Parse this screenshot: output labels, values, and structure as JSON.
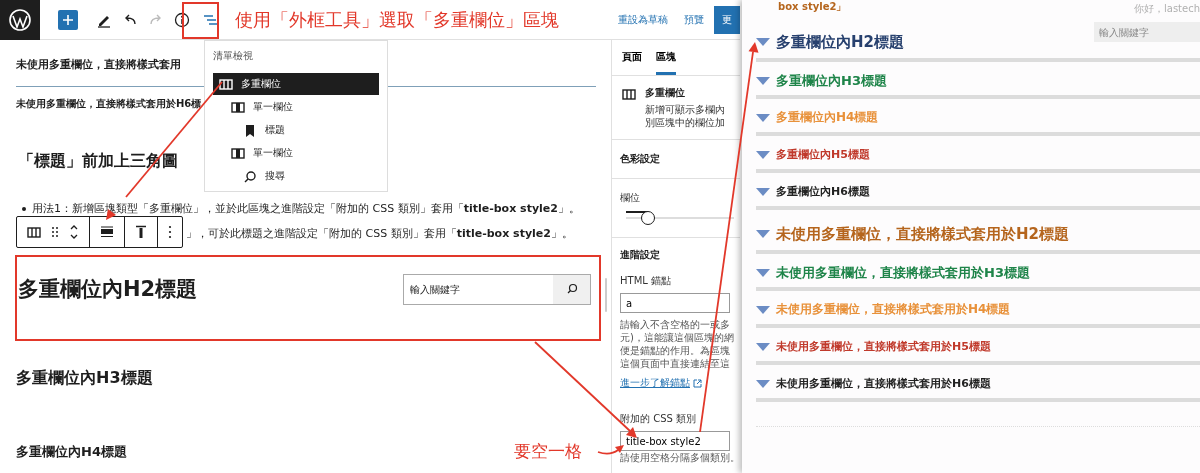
{
  "topbar": {
    "annotation": "使用「外框工具」選取「多重欄位」區塊",
    "links": [
      "重設為草稿",
      "預覽"
    ],
    "update_button": "更"
  },
  "list_view": {
    "title": "清單檢視",
    "items": [
      {
        "label": "多重欄位",
        "kind": "columns",
        "selected": true,
        "children": [
          {
            "label": "單一欄位",
            "kind": "column",
            "selected": false,
            "children": [
              {
                "label": "標題",
                "kind": "heading",
                "selected": false
              }
            ]
          },
          {
            "label": "單一欄位",
            "kind": "column",
            "selected": false,
            "children": [
              {
                "label": "搜尋",
                "kind": "search",
                "selected": false
              }
            ]
          }
        ]
      }
    ]
  },
  "content": {
    "title_line": "未使用多重欄位，直接將樣式套用",
    "small_line": "未使用多重欄位，直接將樣式套用於H6標",
    "section_heading": "「標題」前加上三角圖",
    "bullets": [
      {
        "text": "用法1：新增區塊類型「多重欄位」，並於此區塊之進階設定「附加的 CSS 類別」套用「**title-box style2**」。",
        "marker_visible": true
      },
      {
        "text": "」，可於此標題之進階設定「附加的 CSS 類別」套用「**title-box style2**」。",
        "marker_visible": false
      }
    ],
    "selected_block": {
      "heading": "多重欄位內H2標題",
      "search_placeholder": "輸入關鍵字"
    },
    "headings": [
      {
        "kind": "h3",
        "text": "多重欄位內H3標題"
      },
      {
        "kind": "h4",
        "text": "多重欄位內H4標題"
      }
    ],
    "annotation": "要空一格"
  },
  "sidebar": {
    "tabs": [
      {
        "label": "頁面",
        "selected": false
      },
      {
        "label": "區塊",
        "selected": true
      }
    ],
    "block_card": {
      "name": "多重欄位",
      "description_lines": [
        "新增可顯示多欄內",
        "別區塊中的欄位加"
      ]
    },
    "color_settings": "色彩設定",
    "columns": {
      "label": "欄位",
      "level": 0.2
    },
    "advanced": {
      "title": "進階設定",
      "anchor_label": "HTML 錨點",
      "anchor_value": "a",
      "anchor_help_lines": [
        "請輸入不含空格的一或多",
        "元)，這能讓這個區塊的網",
        "便是錨點的作用。為區塊",
        "這個頁面中直接連結至這"
      ],
      "learn_more": "進一步了解錨點",
      "css_label": "附加的 CSS 類別",
      "css_value": "title-box style2",
      "css_help": "請使用空格分隔多個類別。"
    }
  },
  "front_page": {
    "top_text": "box style2」",
    "greeting": "你好，lastech",
    "search_placeholder": "輸入關鍵字",
    "headings": [
      {
        "kind": "h2",
        "text": "多重欄位內H2標題",
        "color": "#27406e"
      },
      {
        "kind": "h3",
        "text": "多重欄位內H3標題",
        "color": "#1e8449"
      },
      {
        "kind": "h4",
        "text": "多重欄位內H4標題",
        "color": "#e8913a"
      },
      {
        "kind": "h5",
        "text": "多重欄位內H5標題",
        "color": "#c0392b"
      },
      {
        "kind": "h6",
        "text": "多重欄位內H6標題",
        "color": "#222222"
      },
      {
        "kind": "h2",
        "text": "未使用多重欄位，直接將樣式套用於H2標題",
        "color": "#b5651d"
      },
      {
        "kind": "h3",
        "text": "未使用多重欄位，直接將樣式套用於H3標題",
        "color": "#1e8449"
      },
      {
        "kind": "h4",
        "text": "未使用多重欄位，直接將樣式套用於H4標題",
        "color": "#e8913a"
      },
      {
        "kind": "h5",
        "text": "未使用多重欄位，直接將樣式套用於H5標題",
        "color": "#c0392b"
      },
      {
        "kind": "h6",
        "text": "未使用多重欄位，直接將樣式套用於H6標題",
        "color": "#222222"
      }
    ]
  }
}
